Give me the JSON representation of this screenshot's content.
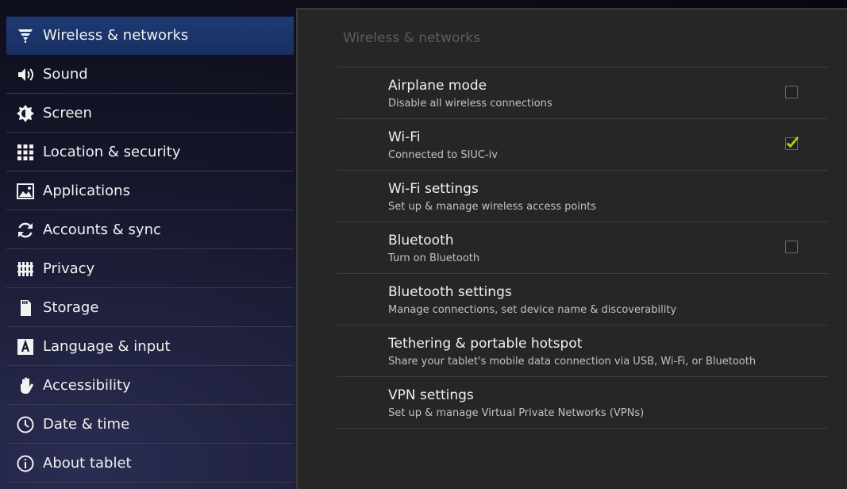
{
  "sidebar": {
    "items": [
      {
        "label": "Wireless & networks",
        "icon": "wireless-icon",
        "selected": true
      },
      {
        "label": "Sound",
        "icon": "speaker-icon"
      },
      {
        "label": "Screen",
        "icon": "brightness-icon"
      },
      {
        "label": "Location & security",
        "icon": "location-grid-icon"
      },
      {
        "label": "Applications",
        "icon": "applications-icon"
      },
      {
        "label": "Accounts & sync",
        "icon": "sync-icon"
      },
      {
        "label": "Privacy",
        "icon": "privacy-fence-icon"
      },
      {
        "label": "Storage",
        "icon": "sd-card-icon"
      },
      {
        "label": "Language & input",
        "icon": "keyboard-letter-icon"
      },
      {
        "label": "Accessibility",
        "icon": "hand-icon"
      },
      {
        "label": "Date & time",
        "icon": "clock-icon"
      },
      {
        "label": "About tablet",
        "icon": "info-icon"
      }
    ]
  },
  "panel": {
    "title": "Wireless & networks",
    "prefs": [
      {
        "title": "Airplane mode",
        "summary": "Disable all wireless connections",
        "checkbox": true,
        "checked": false
      },
      {
        "title": "Wi-Fi",
        "summary": "Connected to SIUC-iv",
        "checkbox": true,
        "checked": true
      },
      {
        "title": "Wi-Fi settings",
        "summary": "Set up & manage wireless access points",
        "checkbox": false
      },
      {
        "title": "Bluetooth",
        "summary": "Turn on Bluetooth",
        "checkbox": true,
        "checked": false
      },
      {
        "title": "Bluetooth settings",
        "summary": "Manage connections, set device name & discoverability",
        "checkbox": false
      },
      {
        "title": "Tethering & portable hotspot",
        "summary": "Share your tablet's mobile data connection via USB, Wi-Fi, or Bluetooth",
        "checkbox": false
      },
      {
        "title": "VPN settings",
        "summary": "Set up & manage Virtual Private Networks (VPNs)",
        "checkbox": false
      }
    ]
  },
  "colors": {
    "selected_bg": "#1f3a73",
    "check_green": "#a8d41a"
  }
}
